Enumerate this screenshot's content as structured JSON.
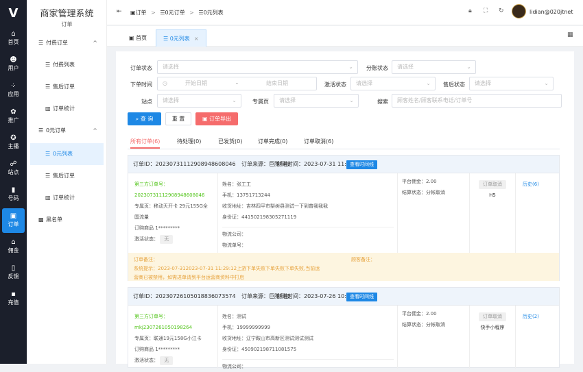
{
  "rail": {
    "logo": "V",
    "items": [
      {
        "label": "首页",
        "icon": "⌂",
        "active": false
      },
      {
        "label": "用户",
        "icon": "☻",
        "active": false
      },
      {
        "label": "应用",
        "icon": "⁘",
        "active": false
      },
      {
        "label": "推广",
        "icon": "✿",
        "active": false
      },
      {
        "label": "主播",
        "icon": "✪",
        "active": false
      },
      {
        "label": "站点",
        "icon": "☍",
        "active": false
      },
      {
        "label": "号码",
        "icon": "▮",
        "active": false
      },
      {
        "label": "订单",
        "icon": "▣",
        "active": true
      },
      {
        "label": "佣金",
        "icon": "⌂",
        "active": false
      },
      {
        "label": "反馈",
        "icon": "▯",
        "active": false
      },
      {
        "label": "充值",
        "icon": "▪",
        "active": false
      }
    ]
  },
  "sidebar": {
    "brand": "商家管理系统",
    "sub": "订单",
    "groups": [
      {
        "label": "付费订单",
        "icon": "☰",
        "caret": "^"
      },
      {
        "label": "付费列表",
        "icon": "☰"
      },
      {
        "label": "售后订单",
        "icon": "☰"
      },
      {
        "label": "订单统计",
        "icon": "▥"
      },
      {
        "label": "0元订单",
        "icon": "☰",
        "caret": "^"
      },
      {
        "label": "0元列表",
        "icon": "☰",
        "active": true
      },
      {
        "label": "售后订单",
        "icon": "☰"
      },
      {
        "label": "订单统计",
        "icon": "▥"
      },
      {
        "label": "黑名单",
        "icon": "▩"
      }
    ]
  },
  "topbar": {
    "breadcrumb": [
      "订单",
      "0元订单",
      "0元列表"
    ],
    "user": "lidian@020jtnet"
  },
  "tabs": [
    {
      "label": "首页"
    },
    {
      "label": "0元列表",
      "close": "×"
    }
  ],
  "filters": {
    "order_status_label": "订单状态",
    "order_status_ph": "请选择",
    "split_status_label": "分账状态",
    "split_status_ph": "请选择",
    "order_time_label": "下单时间",
    "start_date_ph": "开始日期",
    "dash": "-",
    "end_date_ph": "结束日期",
    "activate_label": "激活状态",
    "activate_ph": "请选择",
    "aftersale_label": "售后状态",
    "aftersale_ph": "请选择",
    "site_label": "站点",
    "site_ph": "请选择",
    "zone_label": "专属页",
    "zone_ph": "请选择",
    "search_label": "搜索",
    "search_ph": "顾客姓名/顾客联系电话/订单号"
  },
  "buttons": {
    "query": "查 询",
    "reset": "重 置",
    "export": "订单导出"
  },
  "order_tabs": [
    {
      "label": "所有订单(6)",
      "active": true
    },
    {
      "label": "待处理(0)"
    },
    {
      "label": "已发货(0)"
    },
    {
      "label": "订单完成(0)"
    },
    {
      "label": "订单取消(6)"
    }
  ],
  "orders": [
    {
      "order_id": "订单ID：20230731112908948608046",
      "source": "订单来源：巨腾科技",
      "created": "创建时间：2023-07-31 11:29",
      "time_btn": "查看时间线",
      "third_label": "第三方订单号：",
      "third_no": "20230731112908948608046",
      "zone": "专属页：移动天开卡 29元155G全",
      "zone2": "国流量",
      "product": "订购商品 1*********",
      "activate": "激活状态：",
      "activate_val": "无",
      "name": "姓名：张工工",
      "phone": "手机：13751713244",
      "address": "收货地址：吉林四平市梨树县测试一下到普我我我",
      "idcard": "身份证：441502198305271119",
      "logistics_co": "物流公司：",
      "logistics_no": "物流单号：",
      "commission": "平台佣金：2.00",
      "settle": "结算状态：分帐取消",
      "status_badge": "订单取消",
      "channel": "H5",
      "history": "历史(6)",
      "note_order": "订单备注：",
      "note_customer": "顾客备注：",
      "notice1": "系统提示：2023-07-312023-07-31 11:29:12上游下单失败下单失败下单失败,当前运",
      "notice2": "营商已被禁用，如需进单请到平台运营商资料中打启"
    },
    {
      "order_id": "订单ID：20230726105018836073574",
      "source": "订单来源：巨腾科技",
      "created": "创建时间：2023-07-26 10:50",
      "time_btn": "查看时间线",
      "third_label": "第三方订单号：",
      "third_no": "mkj2307261050198264",
      "zone": "专属页：联通19元158G小江卡",
      "product": "订购商品 1*********",
      "activate": "激活状态：",
      "activate_val": "无",
      "name": "姓名：测试",
      "phone": "手机：19999999999",
      "address": "收货地址：辽宁鞍山市高新区测试测试测试",
      "idcard": "身份证：450902198711081575",
      "logistics_co": "物流公司：",
      "commission": "平台佣金：2.00",
      "settle": "结算状态：分帐取消",
      "status_badge": "订单取消",
      "channel": "快手小程序",
      "history": "历史(2)"
    }
  ]
}
